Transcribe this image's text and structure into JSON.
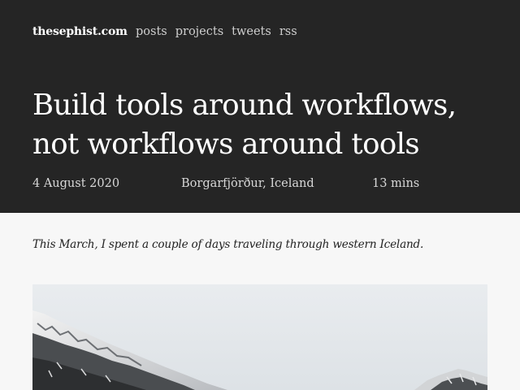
{
  "site": {
    "name": "thesephist.com"
  },
  "nav": {
    "items": [
      "posts",
      "projects",
      "tweets",
      "rss"
    ]
  },
  "article": {
    "title_lines": [
      "Build tools around workflows,",
      "not workflows around tools"
    ],
    "date": "4 August 2020",
    "location": "Borgarfjörður, Iceland",
    "read_time": "13 mins",
    "lead": "This March, I spent a couple of days traveling through western Iceland."
  },
  "colors": {
    "header_bg": "#252525",
    "page_bg": "#f7f7f7"
  }
}
